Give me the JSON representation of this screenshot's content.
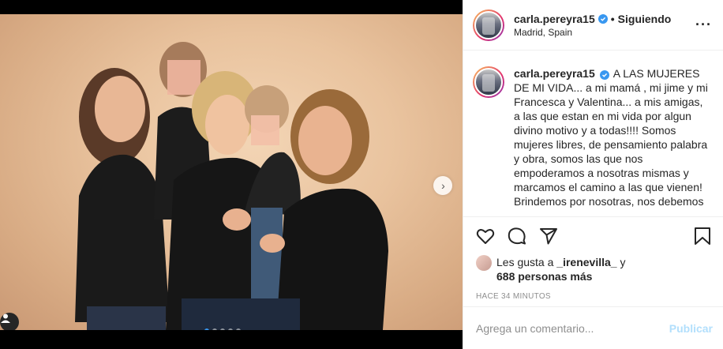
{
  "post": {
    "username": "carla.pereyra15",
    "separator": "•",
    "follow_status": "Siguiendo",
    "location": "Madrid, Spain",
    "more_icon": "more-dots-icon"
  },
  "caption": {
    "username": "carla.pereyra15",
    "text": "A LAS MUJERES DE MI VIDA... a mi mamá , mi jime y mi Francesca y Valentina... a mis amigas, a las que estan en mi vida por algun divino motivo y a todas!!!! Somos mujeres libres, de pensamiento palabra y obra, somos las que nos empoderamos a nosotras mismas y marcamos el camino a las que vienen! Brindemos por nosotras, nos debemos"
  },
  "actions": {
    "like_icon": "heart-icon",
    "comment_icon": "comment-icon",
    "share_icon": "share-icon",
    "save_icon": "bookmark-icon"
  },
  "likes": {
    "prefix": "Les gusta a ",
    "first_user": "_irenevilla_",
    "conj": " y",
    "others": "688 personas más"
  },
  "timestamp": "HACE 34 MINUTOS",
  "comment": {
    "placeholder": "Agrega un comentario...",
    "publish_label": "Publicar"
  },
  "carousel": {
    "count": 5,
    "active_index": 0
  },
  "colors": {
    "accent": "#3897f0",
    "publish_disabled": "#b2dffc",
    "muted": "#8e8e8e"
  }
}
